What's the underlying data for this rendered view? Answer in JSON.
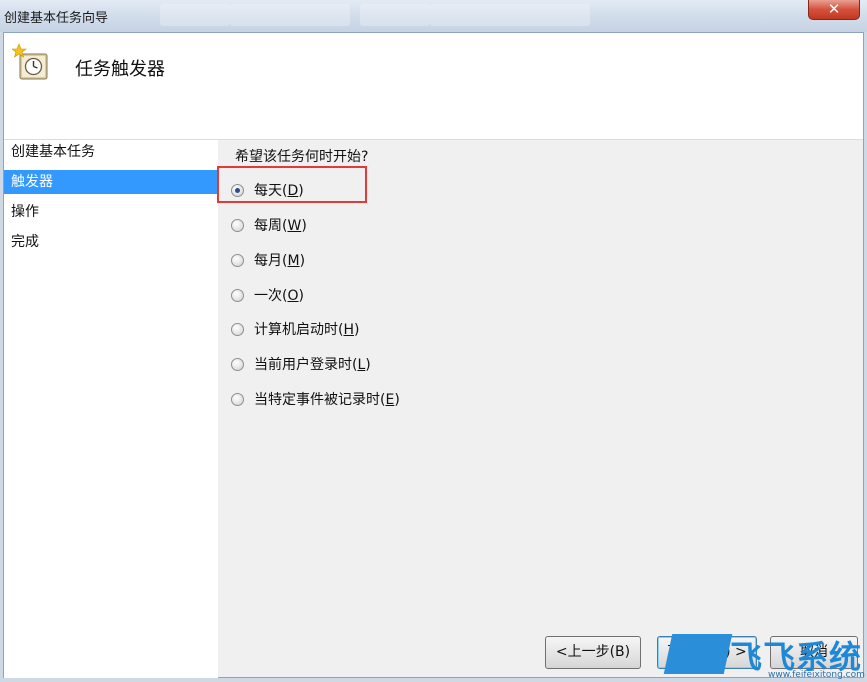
{
  "window": {
    "title": "创建基本任务向导",
    "close_label": "✕"
  },
  "header": {
    "title": "任务触发器",
    "icon": "clock-wizard-icon"
  },
  "nav": {
    "items": [
      {
        "label": "创建基本任务",
        "selected": false
      },
      {
        "label": "触发器",
        "selected": true
      },
      {
        "label": "操作",
        "selected": false
      },
      {
        "label": "完成",
        "selected": false
      }
    ]
  },
  "content": {
    "question": "希望该任务何时开始?",
    "options": [
      {
        "text": "每天(",
        "key": "D",
        "suffix": ")",
        "checked": true
      },
      {
        "text": "每周(",
        "key": "W",
        "suffix": ")",
        "checked": false
      },
      {
        "text": "每月(",
        "key": "M",
        "suffix": ")",
        "checked": false
      },
      {
        "text": "一次(",
        "key": "O",
        "suffix": ")",
        "checked": false
      },
      {
        "text": "计算机启动时(",
        "key": "H",
        "suffix": ")",
        "checked": false
      },
      {
        "text": "当前用户登录时(",
        "key": "L",
        "suffix": ")",
        "checked": false
      },
      {
        "text": "当特定事件被记录时(",
        "key": "E",
        "suffix": ")",
        "checked": false
      }
    ]
  },
  "buttons": {
    "back": "<上一步(B)",
    "next": "下一步(N) >",
    "cancel": "取消"
  },
  "watermark": {
    "text": "飞飞系统",
    "url": "www.feifeixitong.com"
  },
  "colors": {
    "selection": "#3399ff",
    "highlight_box": "#e03a3a",
    "close_button": "#c13821"
  }
}
